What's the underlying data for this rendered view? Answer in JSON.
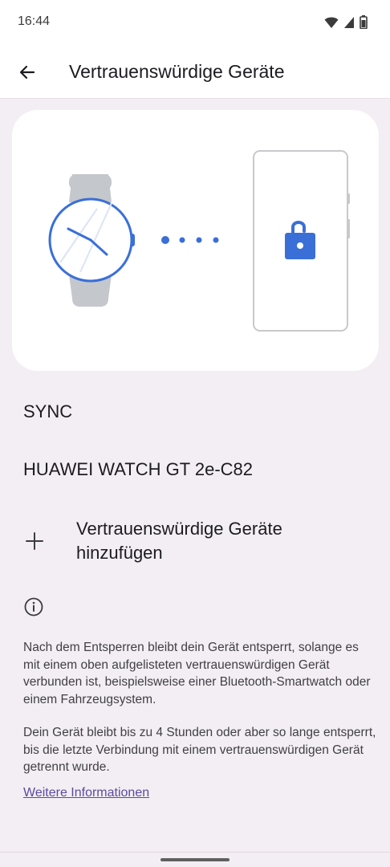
{
  "status_bar": {
    "time": "16:44",
    "icons": [
      "wifi-icon",
      "signal-icon",
      "battery-icon"
    ]
  },
  "app_bar": {
    "title": "Vertrauenswürdige Geräte",
    "back_icon": "arrow-back-icon"
  },
  "illustration": {
    "icons": [
      "smartwatch-icon",
      "connection-dots-icon",
      "phone-icon",
      "unlocked-padlock-icon"
    ],
    "accent_color": "#3a6fd8"
  },
  "devices": [
    {
      "label": "SYNC"
    },
    {
      "label": "HUAWEI WATCH GT 2e-C82"
    }
  ],
  "add_device": {
    "label": "Vertrauenswürdige Geräte hinzufügen",
    "icon": "plus-icon"
  },
  "info": {
    "icon": "info-icon",
    "paragraph1": "Nach dem Entsperren bleibt dein Gerät entsperrt, solange es mit einem oben aufgelisteten vertrauenswürdigen Gerät verbunden ist, beispielsweise einer Bluetooth-Smartwatch oder einem Fahrzeugsystem.",
    "paragraph2": "Dein Gerät bleibt bis zu 4 Stunden oder aber so lange entsperrt, bis die letzte Verbindung mit einem vertrauenswürdigen Gerät getrennt wurde.",
    "link": "Weitere Informationen"
  }
}
